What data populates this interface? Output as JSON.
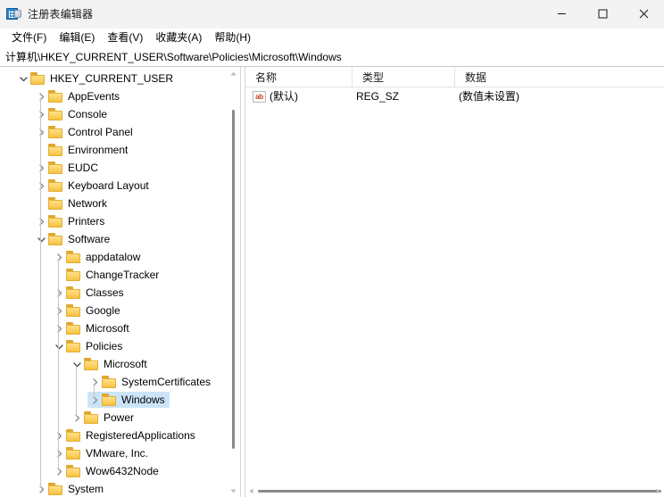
{
  "window": {
    "title": "注册表编辑器",
    "app_icon": "registry-editor-icon",
    "controls": {
      "minimize": "最小化",
      "maximize": "最大化",
      "close": "关闭"
    }
  },
  "menubar": {
    "items": [
      {
        "label": "文件(F)"
      },
      {
        "label": "编辑(E)"
      },
      {
        "label": "查看(V)"
      },
      {
        "label": "收藏夹(A)"
      },
      {
        "label": "帮助(H)"
      }
    ]
  },
  "address": {
    "path": "计算机\\HKEY_CURRENT_USER\\Software\\Policies\\Microsoft\\Windows"
  },
  "tree": {
    "nodes": [
      {
        "label": "HKEY_CURRENT_USER",
        "depth": 0,
        "state": "expanded",
        "selected": false
      },
      {
        "label": "AppEvents",
        "depth": 1,
        "state": "collapsed",
        "selected": false
      },
      {
        "label": "Console",
        "depth": 1,
        "state": "collapsed",
        "selected": false
      },
      {
        "label": "Control Panel",
        "depth": 1,
        "state": "collapsed",
        "selected": false
      },
      {
        "label": "Environment",
        "depth": 1,
        "state": "leaf",
        "selected": false
      },
      {
        "label": "EUDC",
        "depth": 1,
        "state": "collapsed",
        "selected": false
      },
      {
        "label": "Keyboard Layout",
        "depth": 1,
        "state": "collapsed",
        "selected": false
      },
      {
        "label": "Network",
        "depth": 1,
        "state": "leaf",
        "selected": false
      },
      {
        "label": "Printers",
        "depth": 1,
        "state": "collapsed",
        "selected": false
      },
      {
        "label": "Software",
        "depth": 1,
        "state": "expanded",
        "selected": false
      },
      {
        "label": "appdatalow",
        "depth": 2,
        "state": "collapsed",
        "selected": false
      },
      {
        "label": "ChangeTracker",
        "depth": 2,
        "state": "leaf",
        "selected": false
      },
      {
        "label": "Classes",
        "depth": 2,
        "state": "collapsed",
        "selected": false
      },
      {
        "label": "Google",
        "depth": 2,
        "state": "collapsed",
        "selected": false
      },
      {
        "label": "Microsoft",
        "depth": 2,
        "state": "collapsed",
        "selected": false
      },
      {
        "label": "Policies",
        "depth": 2,
        "state": "expanded",
        "selected": false
      },
      {
        "label": "Microsoft",
        "depth": 3,
        "state": "expanded",
        "selected": false
      },
      {
        "label": "SystemCertificates",
        "depth": 4,
        "state": "collapsed",
        "selected": false
      },
      {
        "label": "Windows",
        "depth": 4,
        "state": "collapsed",
        "selected": true
      },
      {
        "label": "Power",
        "depth": 3,
        "state": "collapsed",
        "selected": false
      },
      {
        "label": "RegisteredApplications",
        "depth": 2,
        "state": "collapsed",
        "selected": false
      },
      {
        "label": "VMware, Inc.",
        "depth": 2,
        "state": "collapsed",
        "selected": false
      },
      {
        "label": "Wow6432Node",
        "depth": 2,
        "state": "collapsed",
        "selected": false
      },
      {
        "label": "System",
        "depth": 1,
        "state": "collapsed",
        "selected": false
      }
    ]
  },
  "list": {
    "columns": [
      {
        "label": "名称"
      },
      {
        "label": "类型"
      },
      {
        "label": "数据"
      }
    ],
    "rows": [
      {
        "icon": "string-value-icon",
        "name": "(默认)",
        "type": "REG_SZ",
        "data": "(数值未设置)"
      }
    ]
  },
  "colors": {
    "selection": "#cce4f7",
    "folder": "#fcd063",
    "titlebar": "#f3f3f3",
    "string_icon_text": "#c23b22"
  }
}
